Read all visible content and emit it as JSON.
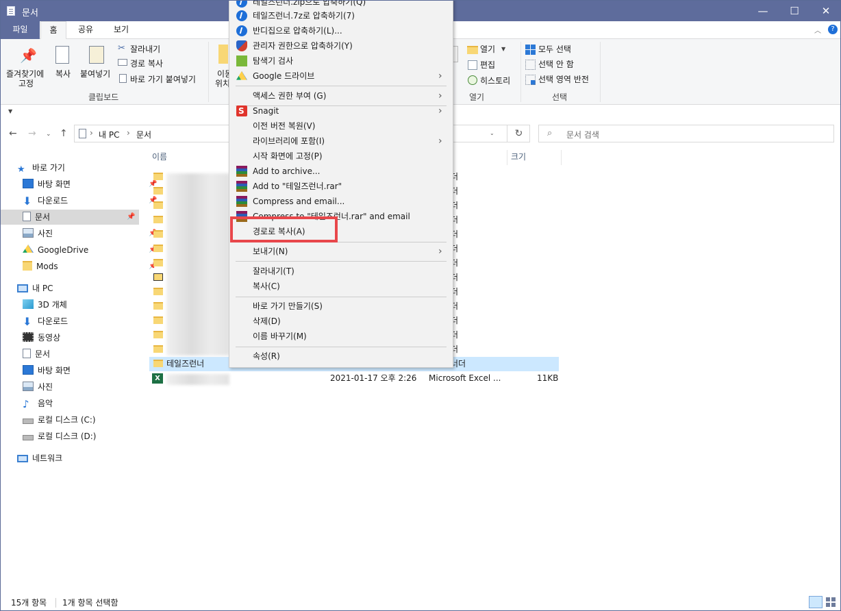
{
  "window": {
    "title": "문서",
    "minimize": "—",
    "maximize": "☐",
    "close": "✕"
  },
  "ribbon_tabs": [
    "파일",
    "홈",
    "공유",
    "보기"
  ],
  "ribbon": {
    "pin_label_1": "즐겨찾기에",
    "pin_label_2": "고정",
    "copy": "복사",
    "paste": "붙여넣기",
    "cut": "잘라내기",
    "copy_path": "경로 복사",
    "paste_shortcut": "바로 가기 붙여넣기",
    "clipboard_group": "클립보드",
    "move_1": "이동",
    "move_2": "위치",
    "open": "열기",
    "edit": "편집",
    "history": "히스토리",
    "open_group": "열기",
    "select_all": "모두 선택",
    "select_none": "선택 안 함",
    "invert_selection": "선택 영역 반전",
    "select_group": "선택"
  },
  "address": {
    "path": [
      "내 PC",
      "문서"
    ],
    "search_placeholder": "문서 검색"
  },
  "columns": {
    "name": "이름",
    "size": "크기"
  },
  "nav": {
    "quick_access": "바로 가기",
    "quick_items": [
      "바탕 화면",
      "다운로드",
      "문서",
      "사진",
      "GoogleDrive",
      "Mods"
    ],
    "this_pc": "내 PC",
    "pc_items": [
      "3D 개체",
      "다운로드",
      "동영상",
      "문서",
      "바탕 화면",
      "사진",
      "음악",
      "로컬 디스크 (C:)",
      "로컬 디스크 (D:)"
    ],
    "network": "네트워크"
  },
  "files": {
    "type_folder": "파일 폴더",
    "selected_name": "테일즈런너",
    "last_date": "2021-01-17 오후 2:26",
    "last_type": "Microsoft Excel ...",
    "last_size": "11KB",
    "partial": [
      "더",
      "더",
      "더",
      "더",
      "더",
      "더",
      "더",
      "더",
      "더",
      "더",
      "더",
      "더",
      "더",
      "너더"
    ]
  },
  "context_menu": {
    "items_top": [
      "테일즈런너.zip으로 압축하기(Q)",
      "테일즈런너.7z로 압축하기(7)",
      "반디집으로 압축하기(L)...",
      "관리자 권한으로 압축하기(Y)",
      "탐색기 검사",
      "Google 드라이브"
    ],
    "items_mid": [
      "액세스 권한 부여 (G)",
      "Snagit",
      "이전 버전 복원(V)",
      "라이브러리에 포함(I)",
      "시작 화면에 고정(P)",
      "Add to archive...",
      "Add to \"테일즈런너.rar\"",
      "Compress and email...",
      "Compress to \"테일즈런너.rar\" and email",
      "경로로 복사(A)"
    ],
    "send_to": "보내기(N)",
    "cut": "잘라내기(T)",
    "copy": "복사(C)",
    "shortcut": "바로 가기 만들기(S)",
    "delete": "삭제(D)",
    "rename": "이름 바꾸기(M)",
    "properties": "속성(R)"
  },
  "status": {
    "count": "15개 항목",
    "selected": "1개 항목 선택함"
  }
}
